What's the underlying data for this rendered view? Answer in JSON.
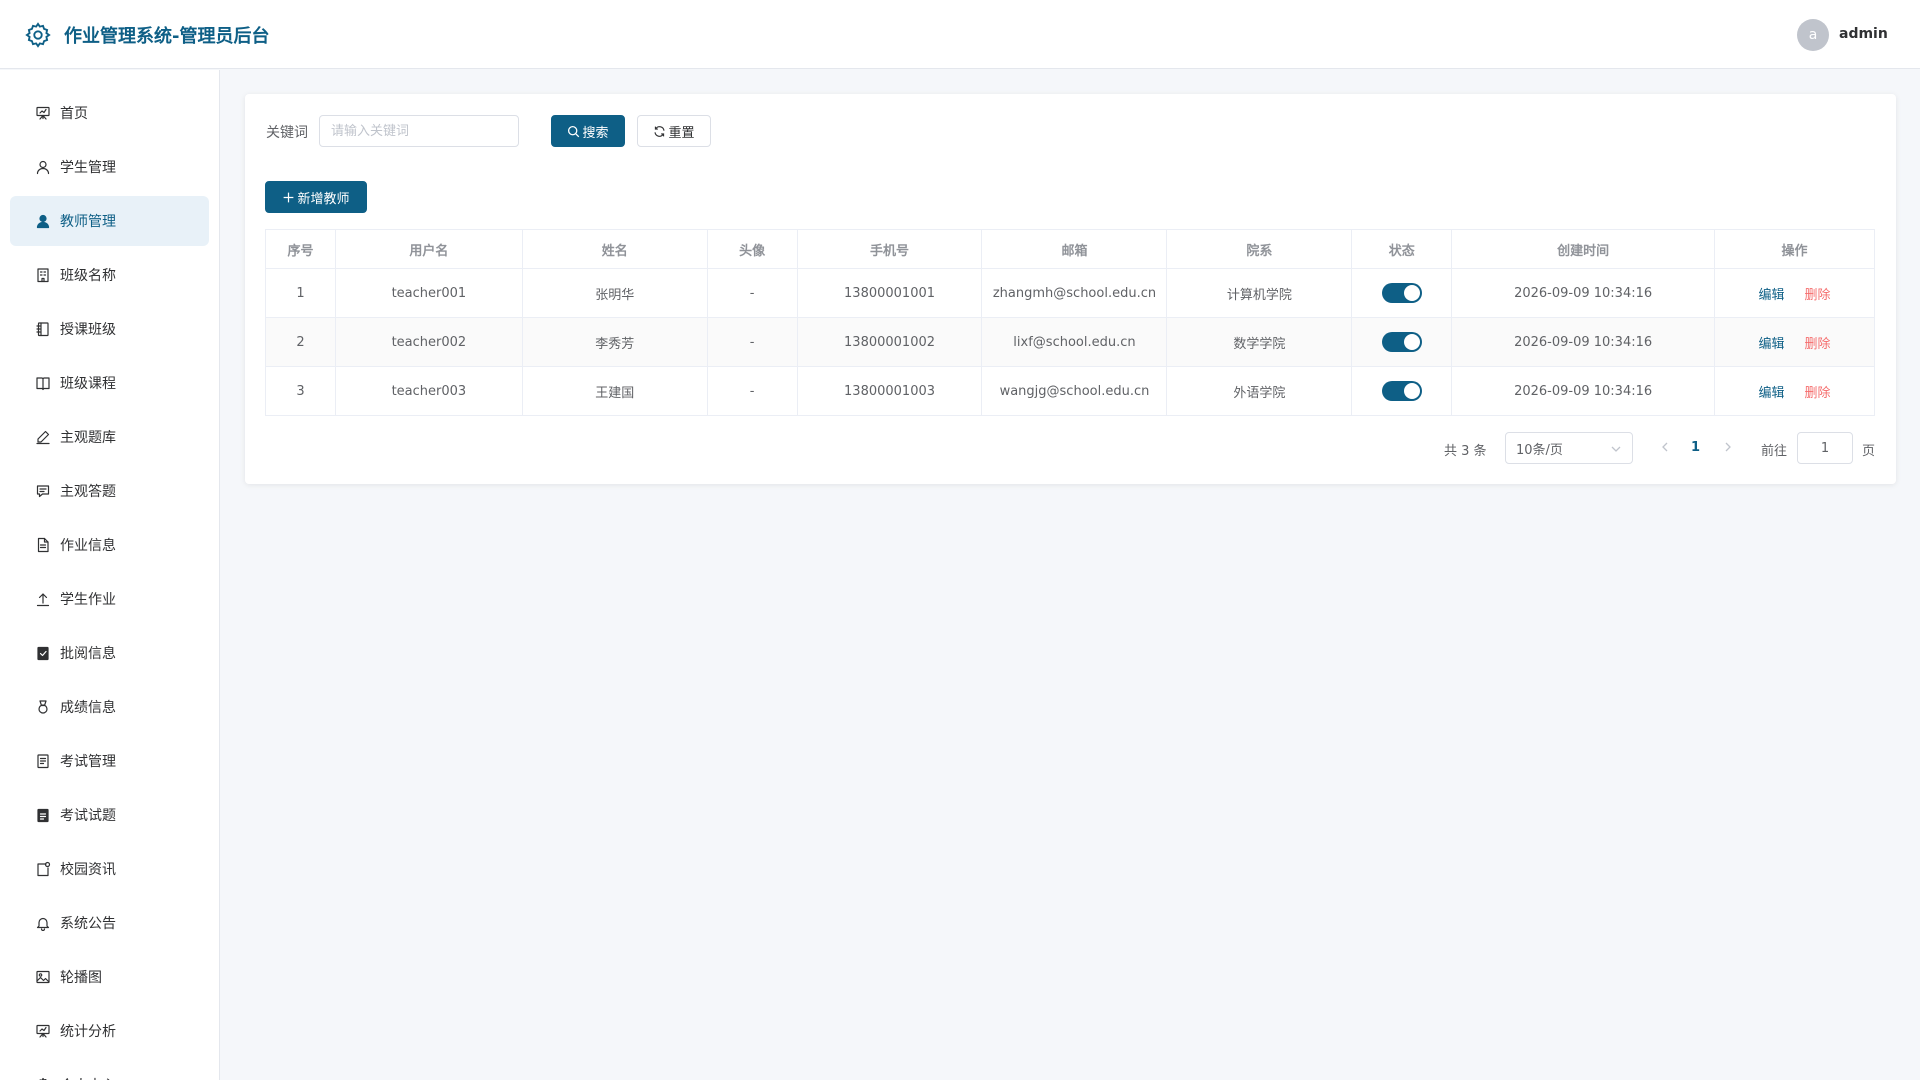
{
  "header": {
    "title": "作业管理系统-管理员后台",
    "user_initial": "a",
    "user_name": "admin"
  },
  "colors": {
    "primary": "#0e5f86",
    "danger": "#f56c6c",
    "active_bg": "#e8f1f8"
  },
  "sidebar": {
    "items": [
      {
        "label": "首页",
        "icon": "presentation-board-icon"
      },
      {
        "label": "学生管理",
        "icon": "user-icon"
      },
      {
        "label": "教师管理",
        "icon": "user-filled-icon",
        "active": true
      },
      {
        "label": "班级名称",
        "icon": "building-icon"
      },
      {
        "label": "授课班级",
        "icon": "notebook-icon"
      },
      {
        "label": "班级课程",
        "icon": "open-book-icon"
      },
      {
        "label": "主观题库",
        "icon": "pen-icon"
      },
      {
        "label": "主观答题",
        "icon": "chat-box-icon"
      },
      {
        "label": "作业信息",
        "icon": "document-icon"
      },
      {
        "label": "学生作业",
        "icon": "upload-icon"
      },
      {
        "label": "批阅信息",
        "icon": "checked-clipboard-icon"
      },
      {
        "label": "成绩信息",
        "icon": "medal-icon"
      },
      {
        "label": "考试管理",
        "icon": "tickets-icon"
      },
      {
        "label": "考试试题",
        "icon": "clipboard-icon"
      },
      {
        "label": "校园资讯",
        "icon": "news-icon"
      },
      {
        "label": "系统公告",
        "icon": "bell-icon"
      },
      {
        "label": "轮播图",
        "icon": "picture-icon"
      },
      {
        "label": "统计分析",
        "icon": "data-board-icon"
      },
      {
        "label": "个人中心",
        "icon": "settings-icon"
      }
    ]
  },
  "search": {
    "label": "关键词",
    "placeholder": "请输入关键词",
    "search_label": "搜索",
    "reset_label": "重置"
  },
  "add_button": "新增教师",
  "table": {
    "headers": [
      "序号",
      "用户名",
      "姓名",
      "头像",
      "手机号",
      "邮箱",
      "院系",
      "状态",
      "创建时间",
      "操作"
    ],
    "rows": [
      {
        "index": "1",
        "username": "teacher001",
        "name": "张明华",
        "avatar": "-",
        "phone": "13800001001",
        "email": "zhangmh@school.edu.cn",
        "dept": "计算机学院",
        "status": true,
        "created": "2026-09-09 10:34:16"
      },
      {
        "index": "2",
        "username": "teacher002",
        "name": "李秀芳",
        "avatar": "-",
        "phone": "13800001002",
        "email": "lixf@school.edu.cn",
        "dept": "数学学院",
        "status": true,
        "created": "2026-09-09 10:34:16"
      },
      {
        "index": "3",
        "username": "teacher003",
        "name": "王建国",
        "avatar": "-",
        "phone": "13800001003",
        "email": "wangjg@school.edu.cn",
        "dept": "外语学院",
        "status": true,
        "created": "2026-09-09 10:34:16"
      }
    ],
    "edit_label": "编辑",
    "delete_label": "删除"
  },
  "pagination": {
    "total": "共 3 条",
    "page_size": "10条/页",
    "current": "1",
    "goto_label": "前往",
    "goto_value": "1",
    "page_suffix": "页"
  }
}
